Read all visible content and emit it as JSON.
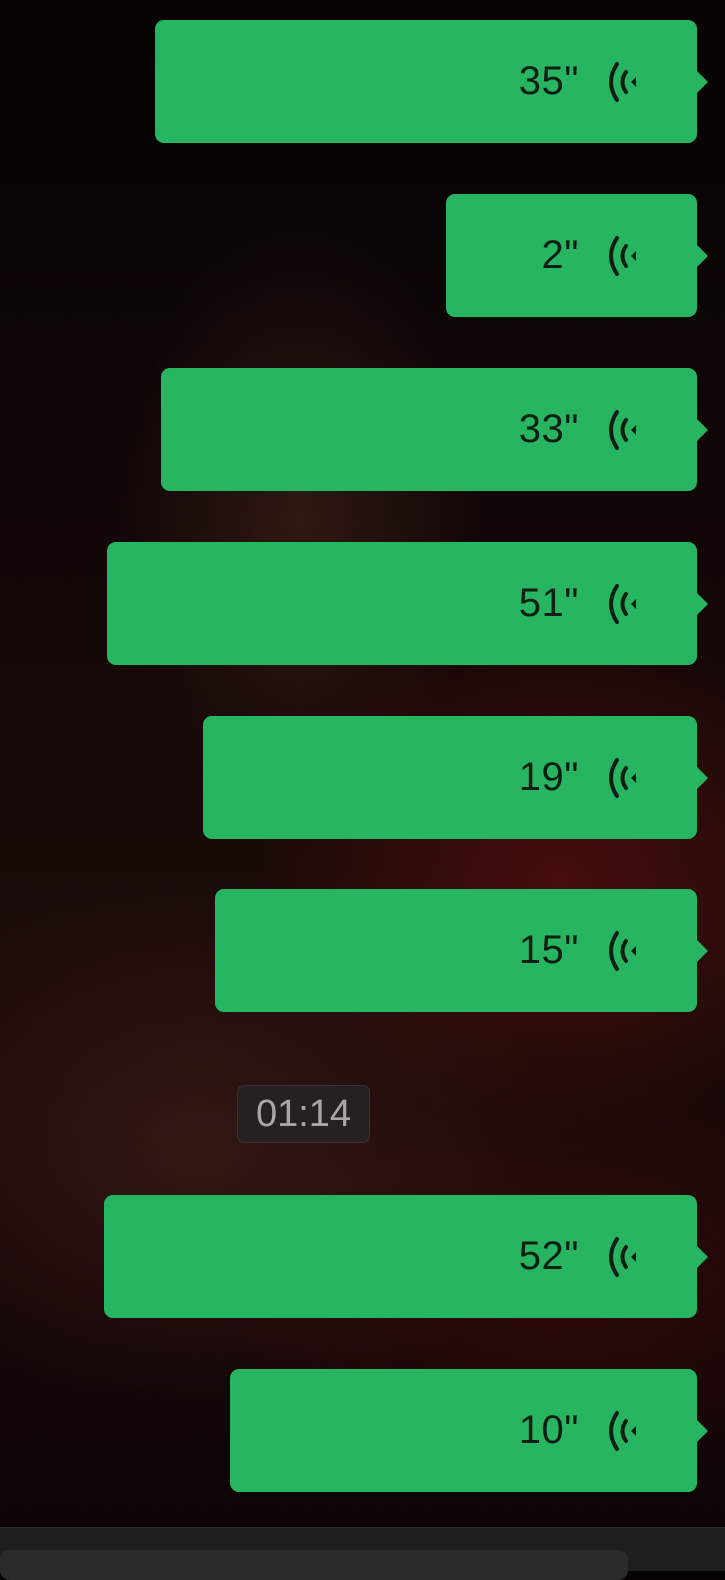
{
  "messages": [
    {
      "duration": "35\""
    },
    {
      "duration": "2\""
    },
    {
      "duration": "33\""
    },
    {
      "duration": "51\""
    },
    {
      "duration": "19\""
    },
    {
      "duration": "15\""
    },
    {
      "timestamp": "01:14"
    },
    {
      "duration": "52\""
    },
    {
      "duration": "10\""
    }
  ],
  "colors": {
    "bubble": "#27b562",
    "bubble_text": "#0d1f12",
    "timestamp_bg": "#262222",
    "timestamp_text": "#a9a6a6"
  },
  "icons": {
    "voice": "voice-wave-icon"
  }
}
